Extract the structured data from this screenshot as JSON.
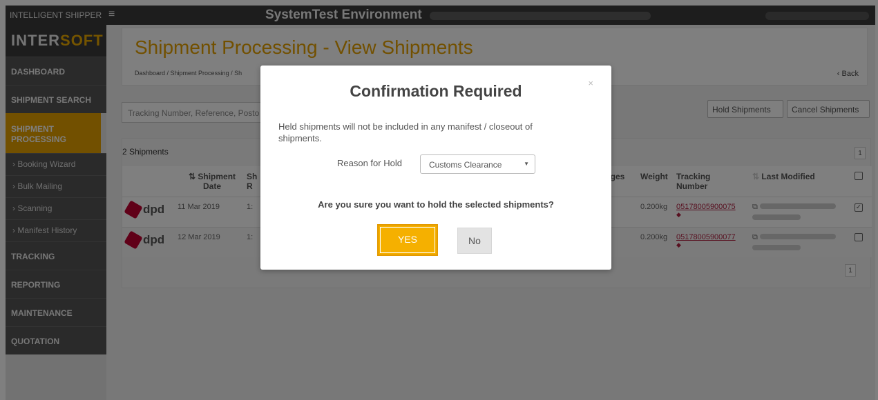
{
  "topbar": {
    "app_name": "INTELLIGENT SHIPPER",
    "environment": "SystemTest Environment"
  },
  "sidebar": {
    "logo": {
      "left": "I",
      "mid": "N",
      "rest": "TER",
      "accent": "SOFT"
    },
    "items": [
      {
        "label": "DASHBOARD"
      },
      {
        "label": "SHIPMENT SEARCH"
      },
      {
        "label": "SHIPMENT PROCESSING",
        "active": true
      },
      {
        "label": "TRACKING"
      },
      {
        "label": "REPORTING"
      },
      {
        "label": "MAINTENANCE"
      },
      {
        "label": "QUOTATION"
      }
    ],
    "sub_items": [
      {
        "label": "› Booking Wizard"
      },
      {
        "label": "› Bulk Mailing"
      },
      {
        "label": "› Scanning"
      },
      {
        "label": "› Manifest History"
      }
    ]
  },
  "header": {
    "title": "Shipment Processing - View Shipments",
    "breadcrumb": "Dashboard  /  Shipment Processing  /  Sh",
    "back_label": "Back"
  },
  "toolbar": {
    "search_placeholder": "Tracking Number, Reference, Posto",
    "hold_label": "Hold Shipments",
    "cancel_label": "Cancel Shipments"
  },
  "list": {
    "count_label": "2 Shipments",
    "page_top": "1",
    "page_bottom": "1",
    "columns": {
      "shipment_date_1": "Shipment",
      "shipment_date_2": "Date",
      "col_s_1": "Sh",
      "col_s_2": "R",
      "packages": "ages",
      "weight": "Weight",
      "tracking_1": "Tracking",
      "tracking_2": "Number",
      "last_modified": "Last Modified"
    },
    "rows": [
      {
        "carrier": "dpd",
        "date": "11 Mar 2019",
        "ref": "1:",
        "weight": "0.200kg",
        "tracking": "05178005900075",
        "checked": "✓"
      },
      {
        "carrier": "dpd",
        "date": "12 Mar 2019",
        "ref": "1:",
        "weight": "0.200kg",
        "tracking": "05178005900077",
        "checked": ""
      }
    ]
  },
  "modal": {
    "close": "×",
    "title": "Confirmation Required",
    "message": "Held shipments will not be included in any manifest / closeout of shipments.",
    "reason_label": "Reason for Hold",
    "reason_value": "Customs Clearance",
    "question": "Are you sure you want to hold the selected shipments?",
    "yes_label": "YES",
    "no_label": "No"
  },
  "colors": {
    "accent": "#e5a000",
    "yes_button": "#f5b000",
    "link": "#b02040",
    "dark": "#3a3a3a"
  },
  "icons": {
    "menu": "hamburger-icon",
    "back": "chevron-left-icon",
    "close": "close-icon",
    "sort": "sort-icon",
    "copy": "copy-icon",
    "tag": "tag-icon"
  }
}
